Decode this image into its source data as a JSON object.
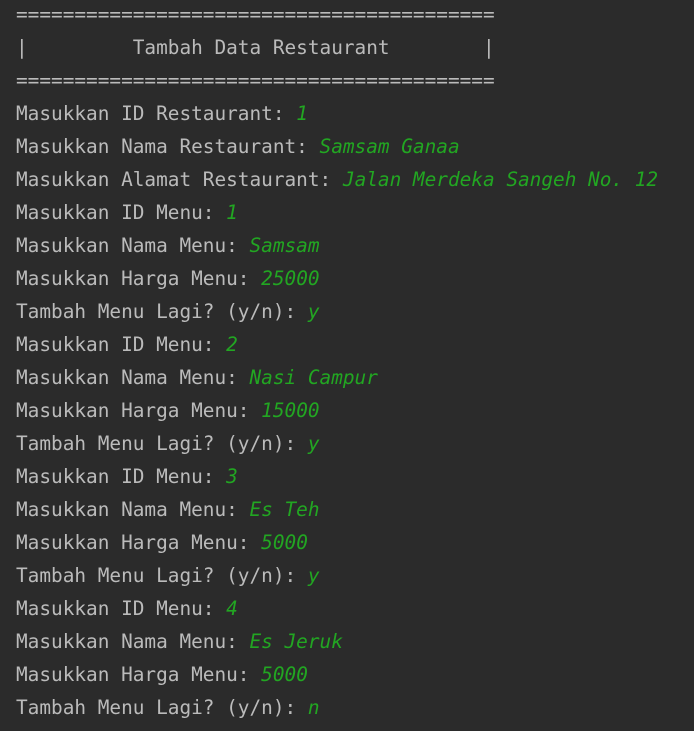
{
  "header": {
    "top_rule": "=========================================",
    "title_row": "|         Tambah Data Restaurant        |",
    "bottom_rule": "========================================="
  },
  "lines": [
    {
      "prompt": "Masukkan ID Restaurant: ",
      "input": "1"
    },
    {
      "prompt": "Masukkan Nama Restaurant: ",
      "input": "Samsam Ganaa"
    },
    {
      "prompt": "Masukkan Alamat Restaurant: ",
      "input": "Jalan Merdeka Sangeh No. 12"
    },
    {
      "prompt": "Masukkan ID Menu: ",
      "input": "1"
    },
    {
      "prompt": "Masukkan Nama Menu: ",
      "input": "Samsam"
    },
    {
      "prompt": "Masukkan Harga Menu: ",
      "input": "25000"
    },
    {
      "prompt": "Tambah Menu Lagi? (y/n): ",
      "input": "y"
    },
    {
      "prompt": "Masukkan ID Menu: ",
      "input": "2"
    },
    {
      "prompt": "Masukkan Nama Menu: ",
      "input": "Nasi Campur"
    },
    {
      "prompt": "Masukkan Harga Menu: ",
      "input": "15000"
    },
    {
      "prompt": "Tambah Menu Lagi? (y/n): ",
      "input": "y"
    },
    {
      "prompt": "Masukkan ID Menu: ",
      "input": "3"
    },
    {
      "prompt": "Masukkan Nama Menu: ",
      "input": "Es Teh"
    },
    {
      "prompt": "Masukkan Harga Menu: ",
      "input": "5000"
    },
    {
      "prompt": "Tambah Menu Lagi? (y/n): ",
      "input": "y"
    },
    {
      "prompt": "Masukkan ID Menu: ",
      "input": "4"
    },
    {
      "prompt": "Masukkan Nama Menu: ",
      "input": "Es Jeruk"
    },
    {
      "prompt": "Masukkan Harga Menu: ",
      "input": "5000"
    },
    {
      "prompt": "Tambah Menu Lagi? (y/n): ",
      "input": "n"
    }
  ],
  "colors": {
    "background": "#2b2b2b",
    "prompt_text": "#bbbbbb",
    "user_input": "#22a622"
  }
}
